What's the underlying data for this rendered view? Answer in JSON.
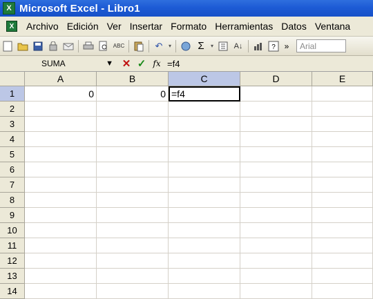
{
  "window": {
    "title": "Microsoft Excel - Libro1"
  },
  "menu": [
    "Archivo",
    "Edición",
    "Ver",
    "Insertar",
    "Formato",
    "Herramientas",
    "Datos",
    "Ventana"
  ],
  "toolbar": {
    "font_name": "Arial",
    "overflow_icon": "chevron-double-right-icon"
  },
  "formula_bar": {
    "name_box": "SUMA",
    "cancel": "✕",
    "enter": "✓",
    "fx": "fx",
    "formula": "=f4"
  },
  "columns": [
    "A",
    "B",
    "C",
    "D",
    "E"
  ],
  "rows": [
    "1",
    "2",
    "3",
    "4",
    "5",
    "6",
    "7",
    "8",
    "9",
    "10",
    "11",
    "12",
    "13",
    "14"
  ],
  "active_cell": {
    "column": "C",
    "row": "1"
  },
  "cells": {
    "A1": "0",
    "B1": "0",
    "C1": "=f4"
  }
}
